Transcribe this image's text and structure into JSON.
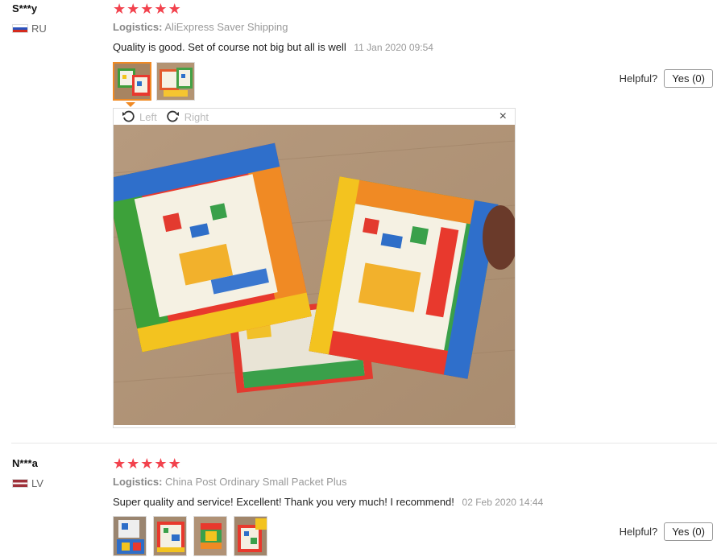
{
  "reviews": [
    {
      "user": "S***y",
      "country": "RU",
      "stars": 5,
      "logistics_label": "Logistics:",
      "logistics_value": "AliExpress Saver Shipping",
      "text": "Quality is good. Set of course not big but all is well",
      "date": "11 Jan 2020 09:54",
      "helpful_label": "Helpful?",
      "yes_label": "Yes (0)"
    },
    {
      "user": "N***a",
      "country": "LV",
      "stars": 5,
      "logistics_label": "Logistics:",
      "logistics_value": "China Post Ordinary Small Packet Plus",
      "text": "Super quality and service! Excellent! Thank you very much! I recommend!",
      "date": "02 Feb 2020 14:44",
      "helpful_label": "Helpful?",
      "yes_label": "Yes (0)"
    }
  ],
  "viewer": {
    "rotate_left": "Left",
    "rotate_right": "Right",
    "close": "×"
  },
  "colors": {
    "star": "#f2424d",
    "active_thumb": "#f08a24"
  }
}
